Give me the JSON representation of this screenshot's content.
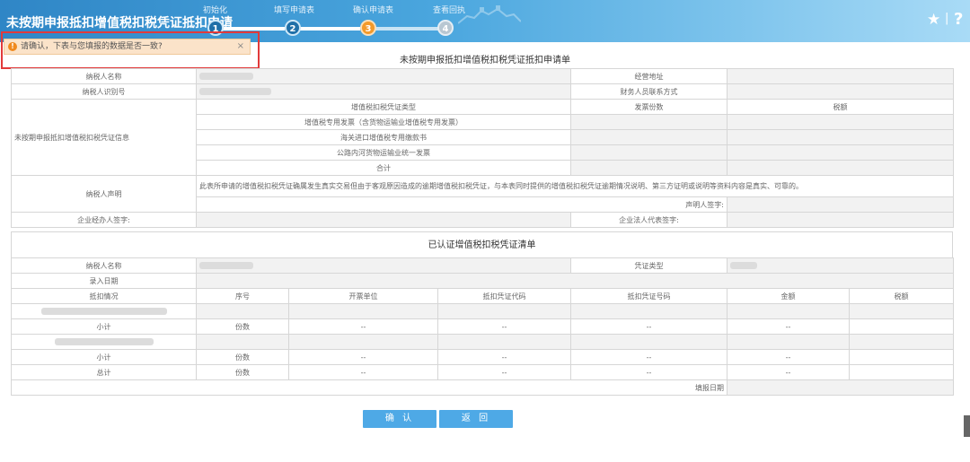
{
  "app": {
    "title": "未按期申报抵扣增值税扣税凭证抵扣申请"
  },
  "steps": [
    {
      "label": "初始化",
      "num": "1",
      "status": "done"
    },
    {
      "label": "填写申请表",
      "num": "2",
      "status": "done"
    },
    {
      "label": "确认申请表",
      "num": "3",
      "status": "current"
    },
    {
      "label": "查看回执",
      "num": "4",
      "status": "pending"
    }
  ],
  "tip": {
    "icon": "!",
    "text": "请确认，下表与您填报的数据是否一致?",
    "close": "×"
  },
  "form_title": "未按期申报抵扣增值税扣税凭证抵扣申请单",
  "table1": {
    "taxpayer_name": "纳税人名称",
    "business_address": "经营地址",
    "taxpayer_id": "纳税人识别号",
    "finance_contact": "财务人员联系方式",
    "voucher_info": "未按期申报抵扣增值税扣税凭证信息",
    "voucher_type": "增值税扣税凭证类型",
    "invoice_count": "发票份数",
    "tax_amount": "税额",
    "voucher_rows": [
      "增值税专用发票（含货物运输业增值税专用发票）",
      "海关进口增值税专用缴款书",
      "公路内河货物运输业统一发票",
      "合计"
    ],
    "declaration_label": "纳税人声明",
    "declaration_text": "此表所申请的增值税扣税凭证确属发生真实交易但由于客观原因造成的逾期增值税扣税凭证，与本表同时提供的增值税扣税凭证逾期情况说明、第三方证明或说明等资料内容是真实、可靠的。",
    "declarant_sign": "声明人签字:",
    "agent_sign": "企业经办人签字:",
    "legal_rep_sign": "企业法人代表签字:"
  },
  "table2": {
    "title": "已认证增值税扣税凭证清单",
    "taxpayer_name": "纳税人名称",
    "voucher_type": "凭证类型",
    "entry_date": "录入日期",
    "headers": [
      "抵扣情况",
      "序号",
      "开票单位",
      "抵扣凭证代码",
      "抵扣凭证号码",
      "金额",
      "税额"
    ],
    "subtotal": "小计",
    "total": "总计",
    "count_label": "份数",
    "dash": "--",
    "fill_date": "填报日期"
  },
  "buttons": {
    "confirm": "确 认",
    "back": "返 回"
  },
  "icons": {
    "favorite": "star-icon",
    "help": "help-icon"
  },
  "colors": {
    "header": "#3b95d3",
    "current_step": "#f39a2a",
    "button": "#4ea9e6",
    "highlight": "#e23a3a"
  }
}
